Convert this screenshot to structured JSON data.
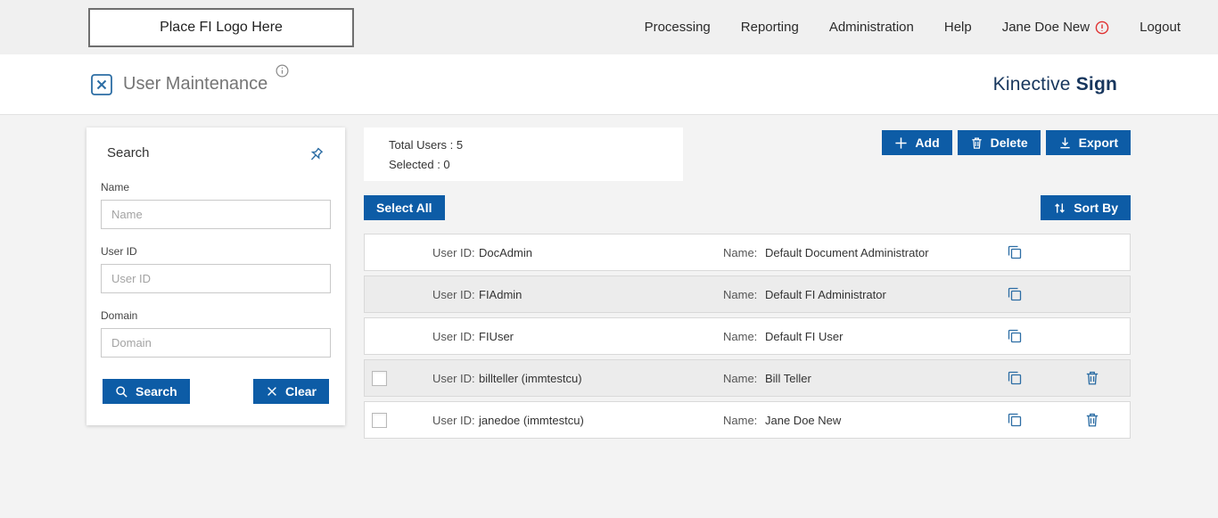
{
  "header": {
    "logo_placeholder": "Place FI Logo Here",
    "nav": [
      {
        "label": "Processing"
      },
      {
        "label": "Reporting"
      },
      {
        "label": "Administration"
      },
      {
        "label": "Help"
      },
      {
        "label": "Jane Doe New",
        "icon": "alert-icon"
      },
      {
        "label": "Logout"
      }
    ]
  },
  "subheader": {
    "page_title": "User Maintenance",
    "brand_name": "Kinective",
    "brand_product": "Sign"
  },
  "search_panel": {
    "title": "Search",
    "fields": [
      {
        "label": "Name",
        "placeholder": "Name",
        "value": ""
      },
      {
        "label": "User ID",
        "placeholder": "User ID",
        "value": ""
      },
      {
        "label": "Domain",
        "placeholder": "Domain",
        "value": ""
      }
    ],
    "search_button": "Search",
    "clear_button": "Clear"
  },
  "toolbar": {
    "total_users_text": "Total Users : 5",
    "selected_text": "Selected : 0",
    "total_users": 5,
    "selected": 0,
    "add": "Add",
    "delete": "Delete",
    "export": "Export",
    "select_all": "Select All",
    "sort_by": "Sort By"
  },
  "users": {
    "user_id_label": "User ID:",
    "name_label": "Name:",
    "rows": [
      {
        "user_id": "DocAdmin",
        "name": "Default Document Administrator",
        "has_checkbox": false,
        "has_delete": false
      },
      {
        "user_id": "FIAdmin",
        "name": "Default FI Administrator",
        "has_checkbox": false,
        "has_delete": false
      },
      {
        "user_id": "FIUser",
        "name": "Default FI User",
        "has_checkbox": false,
        "has_delete": false
      },
      {
        "user_id": "billteller (immtestcu)",
        "name": "Bill Teller",
        "has_checkbox": true,
        "has_delete": true
      },
      {
        "user_id": "janedoe (immtestcu)",
        "name": "Jane Doe New",
        "has_checkbox": true,
        "has_delete": true
      }
    ]
  },
  "icons": {
    "alert-icon": "red-circle-exclamation",
    "info-icon": "gray-circle-i",
    "pin-icon": "pushpin",
    "search-icon": "magnifier",
    "clear-icon": "x-mark",
    "add-icon": "plus",
    "delete-icon": "trash-can",
    "export-icon": "download-arrow",
    "sort-icon": "up-down-arrows",
    "copy-icon": "overlapping-squares",
    "page-icon": "boxed-x-document"
  },
  "colors": {
    "accent_blue": "#0d5ca6",
    "brand_navy": "#17365d",
    "alert_red": "#e03131",
    "row_alt": "#ececec",
    "topbar_bg": "#f0f0f0",
    "icon_blue": "#2c6da4"
  }
}
